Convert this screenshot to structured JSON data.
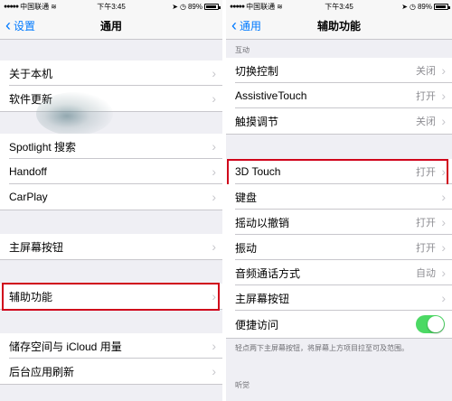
{
  "status_bar": {
    "carrier": "中国联通",
    "time": "下午3:45",
    "battery": "89%",
    "battery_level": 0.89
  },
  "left": {
    "back_label": "设置",
    "title": "通用",
    "rows": [
      {
        "label": "关于本机"
      },
      {
        "label": "软件更新"
      },
      {
        "label": "Spotlight 搜索"
      },
      {
        "label": "Handoff"
      },
      {
        "label": "CarPlay"
      },
      {
        "label": "主屏幕按钮"
      },
      {
        "label": "辅助功能"
      },
      {
        "label": "储存空间与 iCloud 用量"
      },
      {
        "label": "后台应用刷新"
      }
    ]
  },
  "right": {
    "back_label": "通用",
    "title": "辅助功能",
    "section_interaction": "互动",
    "section_hearing": "听觉",
    "rows": [
      {
        "label": "切换控制",
        "value": "关闭"
      },
      {
        "label": "AssistiveTouch",
        "value": "打开"
      },
      {
        "label": "触摸调节",
        "value": "关闭"
      },
      {
        "label": "3D Touch",
        "value": "打开"
      },
      {
        "label": "键盘",
        "value": ""
      },
      {
        "label": "摇动以撤销",
        "value": "打开"
      },
      {
        "label": "振动",
        "value": "打开"
      },
      {
        "label": "音频通话方式",
        "value": "自动"
      },
      {
        "label": "主屏幕按钮",
        "value": ""
      },
      {
        "label": "便捷访问",
        "value": ""
      }
    ],
    "reachability_on": true,
    "footer_note": "轻点两下主屏幕按钮，将屏幕上方项目拉至可及范围。"
  },
  "colors": {
    "accent": "#007aff",
    "highlight": "#d0021b",
    "toggle_on": "#4cd964",
    "background": "#efeff4"
  }
}
